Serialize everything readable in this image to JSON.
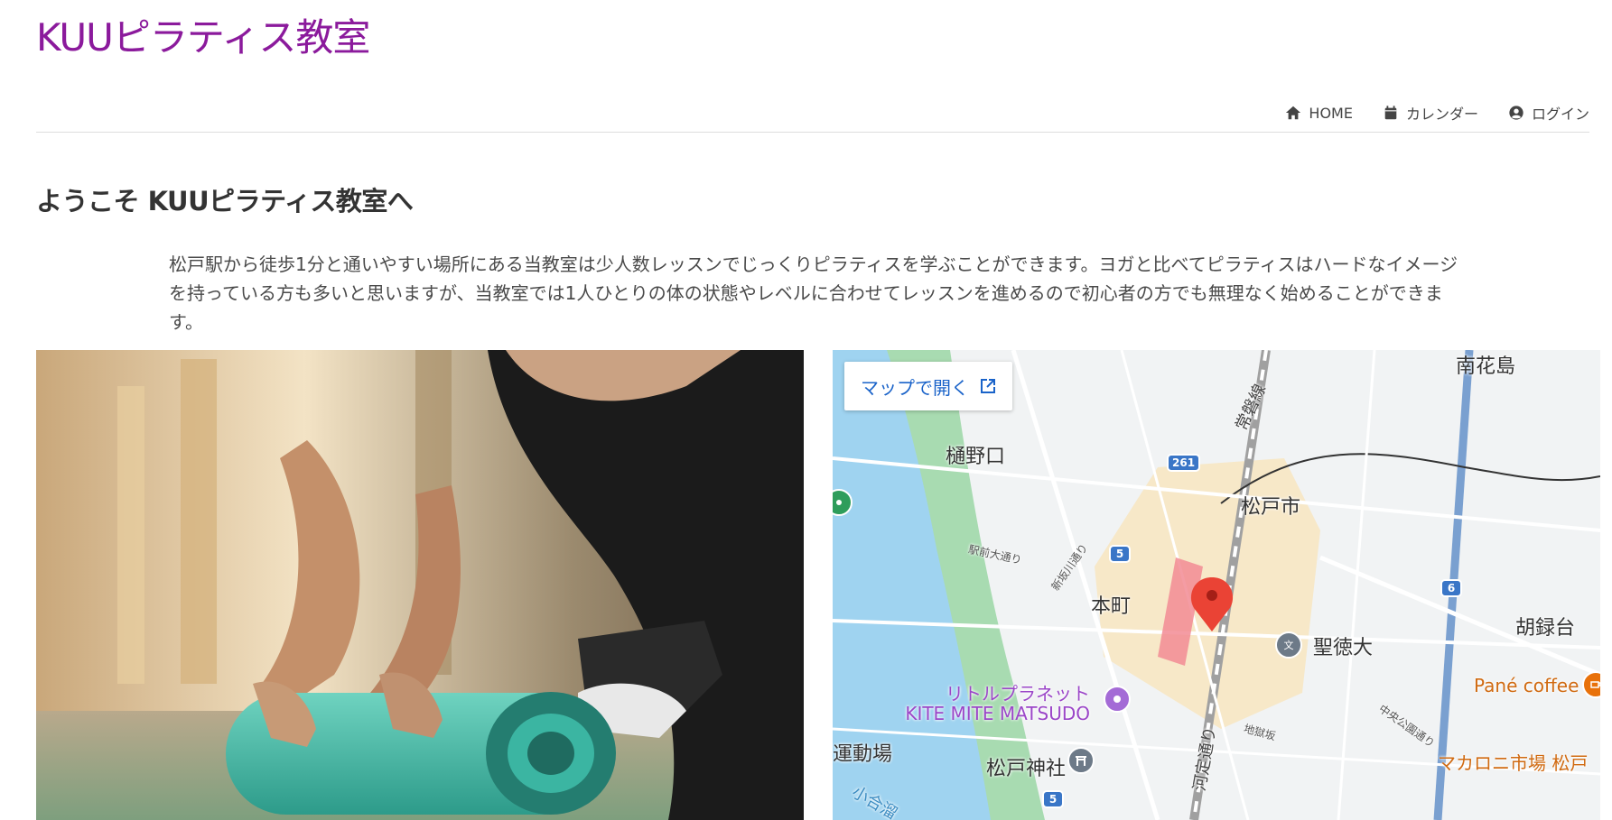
{
  "site": {
    "title": "KUUピラティス教室",
    "title_color": "#8b1a9c"
  },
  "nav": {
    "items": [
      {
        "label": "HOME",
        "icon": "home-icon"
      },
      {
        "label": "カレンダー",
        "icon": "calendar-icon"
      },
      {
        "label": "ログイン",
        "icon": "user-circle-icon"
      }
    ]
  },
  "main": {
    "heading": "ようこそ KUUピラティス教室へ",
    "intro": "松戸駅から徒歩1分と通いやすい場所にある当教室は少人数レッスンでじっくりピラティスを学ぶことができます。ヨガと比べてピラティスはハードなイメージを持っている方も多いと思いますが、当教室では1人ひとりの体の状態やレベルに合わせてレッスンを進めるので初心者の方でも無理なく始めることができます。"
  },
  "map": {
    "open_button": "マップで開く",
    "labels": {
      "minamihanajima": "南花島",
      "hinokuchi": "樋野口",
      "matsudo_city": "松戸市",
      "ekimae_odori": "駅前大通り",
      "shinsakagawa": "新坂川通り",
      "honcho": "本町",
      "seitoku": "聖徳大",
      "korokudai": "胡録台",
      "pane_coffee": "Pané coffee",
      "little_planet": "リトルプラネット KITE MITE MATSUDO",
      "undojo": "運動場",
      "matsudo_shrine": "松戸神社",
      "macaroni": "マカロニ市場 松戸",
      "jigokuzaka": "地獄坂",
      "chuo_koen": "中央公園通り",
      "kaido": "河定通り",
      "jobansen": "常磐線",
      "kogawa": "小合溜"
    },
    "routes": [
      "261",
      "5",
      "6",
      "5"
    ],
    "marker_color": "#ea4335"
  }
}
